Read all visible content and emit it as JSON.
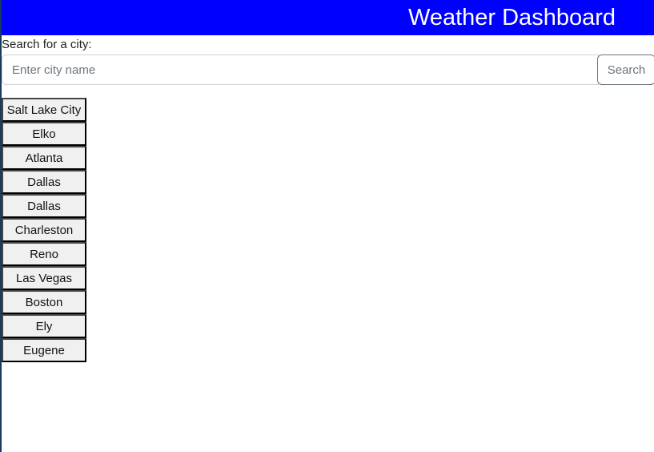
{
  "header": {
    "title": "Weather Dashboard",
    "background_color": "#0000ff"
  },
  "search": {
    "label": "Search for a city:",
    "placeholder": "Enter city name",
    "value": "",
    "button_label": "Search"
  },
  "history": {
    "cities": [
      "Salt Lake City",
      "Elko",
      "Atlanta",
      "Dallas",
      "Dallas",
      "Charleston",
      "Reno",
      "Las Vegas",
      "Boston",
      "Ely",
      "Eugene"
    ]
  }
}
